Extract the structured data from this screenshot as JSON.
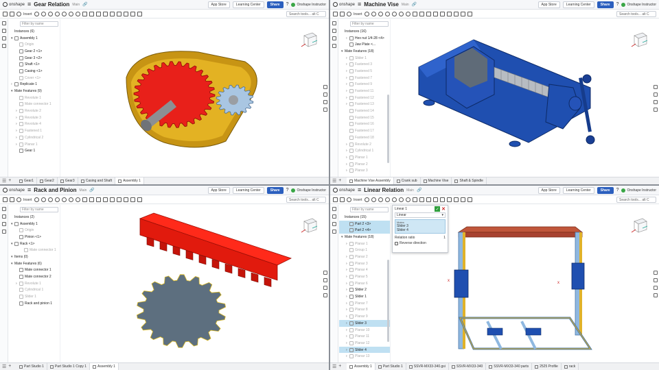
{
  "common": {
    "logo": "onshape",
    "workspace": "Main",
    "app_store": "App Store",
    "learning_center": "Learning Center",
    "share": "Share",
    "help": "?",
    "user": "Onshape Instructor",
    "search": "Search tools...",
    "search_hint": "alt C",
    "filter_placeholder": "Filter by name",
    "insert": "Insert"
  },
  "q1": {
    "title": "Gear Relation",
    "tree": [
      {
        "label": "Instances (6)",
        "indent": 0,
        "arrow": "",
        "icon": false,
        "sup": false
      },
      {
        "label": "Assembly 1",
        "indent": 0,
        "arrow": "▾",
        "icon": true,
        "sup": false
      },
      {
        "label": "Origin",
        "indent": 1,
        "arrow": "",
        "icon": true,
        "sup": true
      },
      {
        "label": "Gear 2 <1>",
        "indent": 1,
        "arrow": "",
        "icon": true,
        "sup": false
      },
      {
        "label": "Gear 3 <2>",
        "indent": 1,
        "arrow": "",
        "icon": true,
        "sup": false
      },
      {
        "label": "Shaft <1>",
        "indent": 1,
        "arrow": "",
        "icon": true,
        "sup": false
      },
      {
        "label": "Casing <1>",
        "indent": 1,
        "arrow": "",
        "icon": true,
        "sup": false
      },
      {
        "label": "Cover <1>",
        "indent": 1,
        "arrow": "",
        "icon": true,
        "sup": true
      },
      {
        "label": "Replicate 1",
        "indent": 0,
        "arrow": "›",
        "icon": true,
        "sup": false
      },
      {
        "label": "Mate Features (9)",
        "indent": 0,
        "arrow": "▾",
        "icon": false,
        "sup": false
      },
      {
        "label": "Revolute 1",
        "indent": 1,
        "arrow": "",
        "icon": true,
        "sup": true
      },
      {
        "label": "Mate connector 1",
        "indent": 1,
        "arrow": "",
        "icon": true,
        "sup": true
      },
      {
        "label": "Revolute 2",
        "indent": 1,
        "arrow": "›",
        "icon": true,
        "sup": true
      },
      {
        "label": "Revolute 3",
        "indent": 1,
        "arrow": "›",
        "icon": true,
        "sup": true
      },
      {
        "label": "Revolute 4",
        "indent": 1,
        "arrow": "›",
        "icon": true,
        "sup": true
      },
      {
        "label": "Fastened 1",
        "indent": 1,
        "arrow": "›",
        "icon": true,
        "sup": true
      },
      {
        "label": "Cylindrical 2",
        "indent": 1,
        "arrow": "›",
        "icon": true,
        "sup": true
      },
      {
        "label": "Planar 1",
        "indent": 1,
        "arrow": "›",
        "icon": true,
        "sup": true
      },
      {
        "label": "Gear 1",
        "indent": 1,
        "arrow": "",
        "icon": true,
        "sup": false
      }
    ],
    "tabs": [
      "Gear1",
      "Gear2",
      "Gear3",
      "Casing and Shaft",
      "Assembly 1"
    ],
    "active_tab": 4
  },
  "q2": {
    "title": "Machine Vise",
    "tree": [
      {
        "label": "Instances (16)",
        "indent": 0,
        "arrow": "",
        "icon": false,
        "sup": false
      },
      {
        "label": "Hex nut 1/4-28 <4>",
        "indent": 1,
        "arrow": "›",
        "icon": true,
        "sup": false
      },
      {
        "label": "Jaw Plate <...",
        "indent": 1,
        "arrow": "",
        "icon": true,
        "sup": false
      },
      {
        "label": "Mate Features (18)",
        "indent": 0,
        "arrow": "▾",
        "icon": false,
        "sup": false
      },
      {
        "label": "Slider 1",
        "indent": 1,
        "arrow": "›",
        "icon": true,
        "sup": true
      },
      {
        "label": "Fastened 3",
        "indent": 1,
        "arrow": "›",
        "icon": true,
        "sup": true
      },
      {
        "label": "Fastened 5",
        "indent": 1,
        "arrow": "›",
        "icon": true,
        "sup": true
      },
      {
        "label": "Fastened 7",
        "indent": 1,
        "arrow": "›",
        "icon": true,
        "sup": true
      },
      {
        "label": "Fastened 9",
        "indent": 1,
        "arrow": "›",
        "icon": true,
        "sup": true
      },
      {
        "label": "Fastened 11",
        "indent": 1,
        "arrow": "›",
        "icon": true,
        "sup": true
      },
      {
        "label": "Fastened 12",
        "indent": 1,
        "arrow": "›",
        "icon": true,
        "sup": true
      },
      {
        "label": "Fastened 13",
        "indent": 1,
        "arrow": "›",
        "icon": true,
        "sup": true
      },
      {
        "label": "Fastened 14",
        "indent": 1,
        "arrow": "",
        "icon": true,
        "sup": true
      },
      {
        "label": "Fastened 15",
        "indent": 1,
        "arrow": "",
        "icon": true,
        "sup": true
      },
      {
        "label": "Fastened 16",
        "indent": 1,
        "arrow": "",
        "icon": true,
        "sup": true
      },
      {
        "label": "Fastened 17",
        "indent": 1,
        "arrow": "",
        "icon": true,
        "sup": true
      },
      {
        "label": "Fastened 18",
        "indent": 1,
        "arrow": "",
        "icon": true,
        "sup": true
      },
      {
        "label": "Revolute 2",
        "indent": 1,
        "arrow": "›",
        "icon": true,
        "sup": true
      },
      {
        "label": "Cylindrical 1",
        "indent": 1,
        "arrow": "›",
        "icon": true,
        "sup": true
      },
      {
        "label": "Planar 1",
        "indent": 1,
        "arrow": "›",
        "icon": true,
        "sup": true
      },
      {
        "label": "Planar 2",
        "indent": 1,
        "arrow": "›",
        "icon": true,
        "sup": true
      },
      {
        "label": "Planar 3",
        "indent": 1,
        "arrow": "›",
        "icon": true,
        "sup": true
      }
    ],
    "tabs": [
      "Machine Vise Assembly",
      "Crank sub",
      "Machine Vise",
      "Shaft & Spindle"
    ],
    "active_tab": 0
  },
  "q3": {
    "title": "Rack and Pinion",
    "tree": [
      {
        "label": "Instances (2)",
        "indent": 0,
        "arrow": "",
        "icon": false,
        "sup": false
      },
      {
        "label": "Assembly 1",
        "indent": 0,
        "arrow": "▾",
        "icon": true,
        "sup": false
      },
      {
        "label": "Origin",
        "indent": 1,
        "arrow": "",
        "icon": true,
        "sup": true
      },
      {
        "label": "Pinion <1>",
        "indent": 1,
        "arrow": "",
        "icon": true,
        "sup": false
      },
      {
        "label": "Rack <1>",
        "indent": 0,
        "arrow": "▾",
        "icon": true,
        "sup": false
      },
      {
        "label": "Mate connector 1",
        "indent": 2,
        "arrow": "",
        "icon": true,
        "sup": true
      },
      {
        "label": "Items (0)",
        "indent": 0,
        "arrow": "▾",
        "icon": false,
        "sup": false
      },
      {
        "label": "Mate Features (6)",
        "indent": 0,
        "arrow": "▾",
        "icon": false,
        "sup": false
      },
      {
        "label": "Mate connector 1",
        "indent": 1,
        "arrow": "",
        "icon": true,
        "sup": false
      },
      {
        "label": "Mate connector 2",
        "indent": 1,
        "arrow": "",
        "icon": true,
        "sup": false
      },
      {
        "label": "Revolute 1",
        "indent": 1,
        "arrow": "›",
        "icon": true,
        "sup": true
      },
      {
        "label": "Cylindrical 1",
        "indent": 1,
        "arrow": "",
        "icon": true,
        "sup": true
      },
      {
        "label": "Slider 1",
        "indent": 1,
        "arrow": "",
        "icon": true,
        "sup": true
      },
      {
        "label": "Rack and pinion 1",
        "indent": 1,
        "arrow": "",
        "icon": true,
        "sup": false
      }
    ],
    "tabs": [
      "Part Studio 1",
      "Part Studio 1 Copy 1",
      "Assembly 1"
    ],
    "active_tab": 2
  },
  "q4": {
    "title": "Linear Relation",
    "tree": [
      {
        "label": "Instances (15)",
        "indent": 0,
        "arrow": "",
        "icon": false,
        "sup": false
      },
      {
        "label": "Part 2 <3>",
        "indent": 1,
        "arrow": "",
        "icon": true,
        "sup": false,
        "hl": true
      },
      {
        "label": "Part 2 <4>",
        "indent": 1,
        "arrow": "",
        "icon": true,
        "sup": false,
        "hl": true
      },
      {
        "label": "Mate Features (18)",
        "indent": 0,
        "arrow": "▾",
        "icon": false,
        "sup": false
      },
      {
        "label": "Planar 1",
        "indent": 1,
        "arrow": "›",
        "icon": true,
        "sup": true
      },
      {
        "label": "Group 1",
        "indent": 1,
        "arrow": "",
        "icon": true,
        "sup": true
      },
      {
        "label": "Planar 2",
        "indent": 1,
        "arrow": "›",
        "icon": true,
        "sup": true
      },
      {
        "label": "Planar 3",
        "indent": 1,
        "arrow": "›",
        "icon": true,
        "sup": true
      },
      {
        "label": "Planar 4",
        "indent": 1,
        "arrow": "›",
        "icon": true,
        "sup": true
      },
      {
        "label": "Planar 5",
        "indent": 1,
        "arrow": "›",
        "icon": true,
        "sup": true
      },
      {
        "label": "Planar 6",
        "indent": 1,
        "arrow": "›",
        "icon": true,
        "sup": true
      },
      {
        "label": "Slider 2",
        "indent": 1,
        "arrow": "›",
        "icon": true,
        "sup": false
      },
      {
        "label": "Slider 1",
        "indent": 1,
        "arrow": "›",
        "icon": true,
        "sup": false
      },
      {
        "label": "Planar 7",
        "indent": 1,
        "arrow": "›",
        "icon": true,
        "sup": true
      },
      {
        "label": "Planar 8",
        "indent": 1,
        "arrow": "›",
        "icon": true,
        "sup": true
      },
      {
        "label": "Planar 9",
        "indent": 1,
        "arrow": "›",
        "icon": true,
        "sup": true
      },
      {
        "label": "Slider 3",
        "indent": 1,
        "arrow": "›",
        "icon": true,
        "sup": false,
        "hl": true
      },
      {
        "label": "Planar 10",
        "indent": 1,
        "arrow": "›",
        "icon": true,
        "sup": true
      },
      {
        "label": "Planar 11",
        "indent": 1,
        "arrow": "›",
        "icon": true,
        "sup": true
      },
      {
        "label": "Planar 12",
        "indent": 1,
        "arrow": "›",
        "icon": true,
        "sup": true
      },
      {
        "label": "Slider 4",
        "indent": 1,
        "arrow": "›",
        "icon": true,
        "sup": false,
        "hl": true
      },
      {
        "label": "Planar 13",
        "indent": 1,
        "arrow": "›",
        "icon": true,
        "sup": true
      }
    ],
    "tabs": [
      "Assembly 1",
      "Part Studio 1",
      "SSVR-MX33-340.gsi",
      "SSVR-MX33-340",
      "SSVR-MX33-340 parts",
      "2525 Profile",
      "rack"
    ],
    "active_tab": 0,
    "dialog": {
      "title": "Linear 1",
      "type": "Linear",
      "section": "Mates",
      "mate1": "Slider 3",
      "mate2": "Slider 4",
      "ratio_label": "Relation ratio",
      "ratio_value": "1",
      "reverse": "Reverse direction"
    }
  },
  "viewcube": {
    "front": "Front",
    "right": "Right",
    "top": "Top"
  }
}
